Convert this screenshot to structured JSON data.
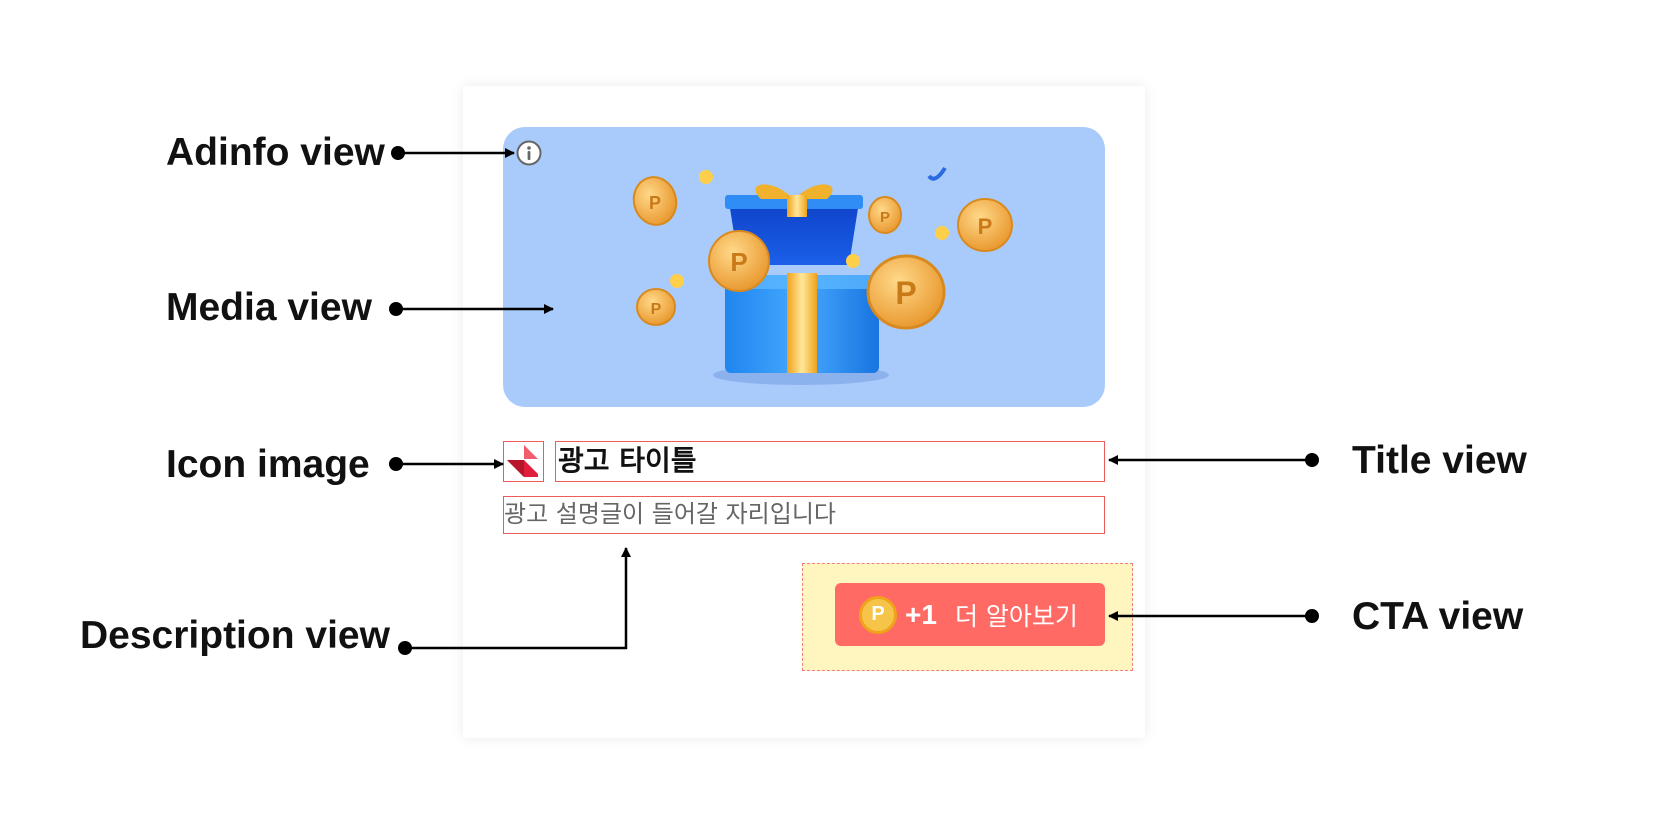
{
  "labels": {
    "adinfo": "Adinfo view",
    "media": "Media view",
    "icon": "Icon image",
    "description": "Description view",
    "title": "Title view",
    "cta": "CTA view"
  },
  "ad": {
    "title": "광고 타이틀",
    "description": "광고 설명글이 들어갈 자리입니다",
    "cta": {
      "coin_symbol": "P",
      "reward": "+1",
      "label": "더 알아보기"
    },
    "media_image": "gift-box-with-coins"
  },
  "colors": {
    "media_bg": "#a9cbfb",
    "highlight_border": "#ef5a5a",
    "cta_area_bg": "#fff5bf",
    "cta_button": "#ff6b64",
    "coin": "#f7c44a"
  }
}
